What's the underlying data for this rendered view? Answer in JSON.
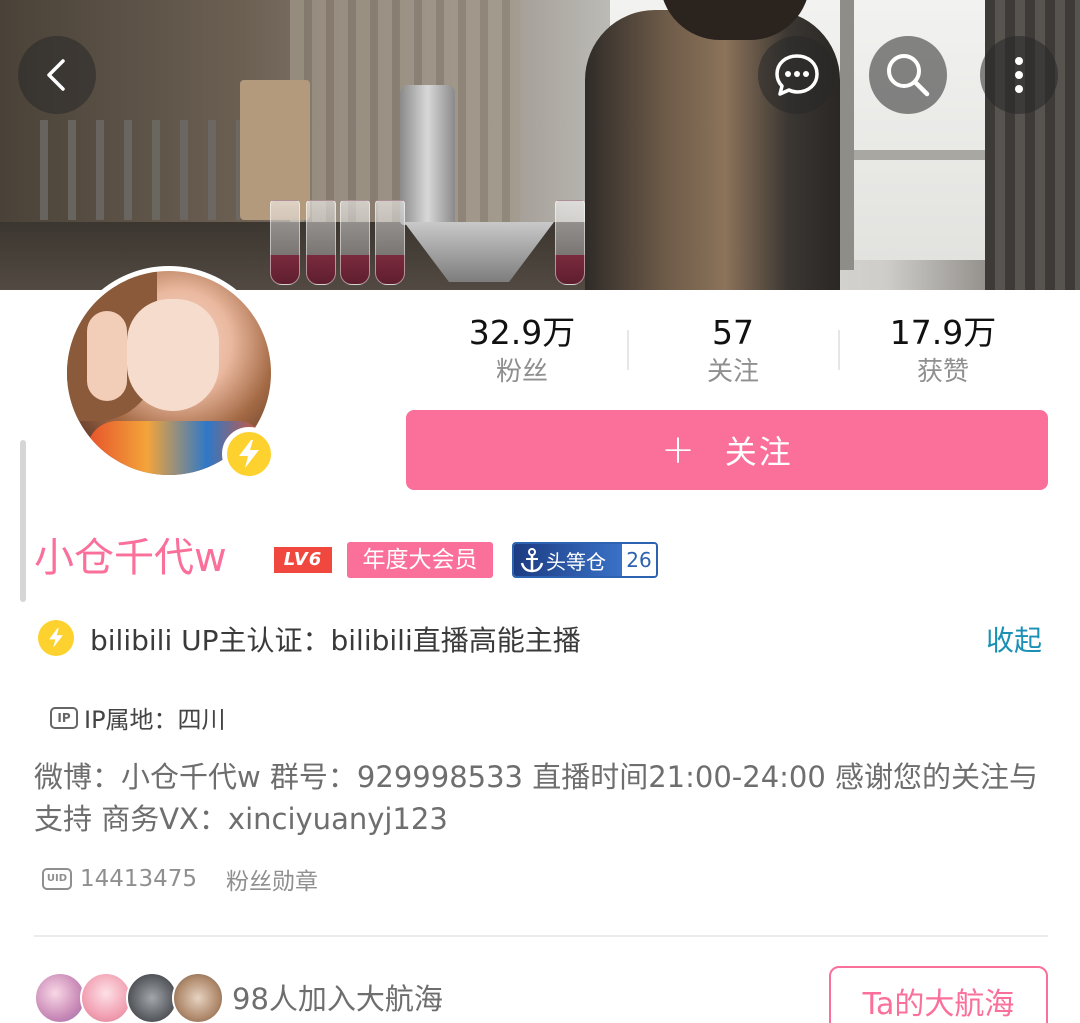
{
  "header": {
    "back_icon": "chevron-left-icon",
    "message_icon": "chat-bubble-icon",
    "search_icon": "search-icon",
    "more_icon": "more-vertical-icon"
  },
  "stats": {
    "fans": {
      "value": "32.9万",
      "label": "粉丝"
    },
    "following": {
      "value": "57",
      "label": "关注"
    },
    "likes": {
      "value": "17.9万",
      "label": "获赞"
    }
  },
  "follow_button": {
    "label": "关注",
    "icon": "plus-icon"
  },
  "profile": {
    "name": "小仓千代w",
    "level": "LV6",
    "vip_badge": "年度大会员",
    "fan_medal": {
      "name": "头等仓",
      "level": "26"
    }
  },
  "certification": {
    "text": "bilibili UP主认证：bilibili直播高能主播",
    "collapse_label": "收起"
  },
  "ip": {
    "tag": "IP",
    "text": "IP属地：四川"
  },
  "bio": "微博：小仓千代w 群号：929998533 直播时间21:00-24:00 感谢您的关注与支持 商务VX：xinciyuanyj123",
  "uid": {
    "tag": "UID",
    "value": "14413475"
  },
  "fans_medal_link": "粉丝勋章",
  "guard": {
    "text": "98人加入大航海",
    "button": "Ta的大航海"
  },
  "colors": {
    "accent_pink": "#fb6f9b",
    "link_blue": "#1a90b5",
    "level_red": "#f0483e",
    "cert_yellow": "#fdd22e"
  }
}
